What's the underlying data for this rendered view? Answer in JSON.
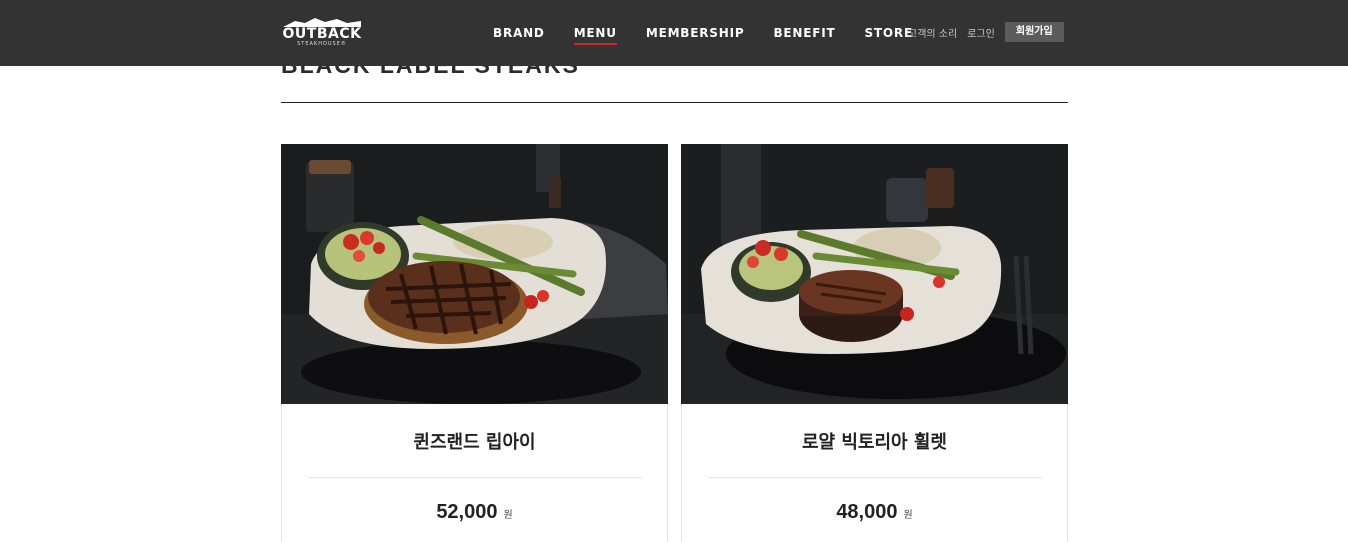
{
  "header": {
    "logo_text": "OUTBACK",
    "logo_subtext": "STEAKHOUSE®",
    "nav": [
      {
        "label": "BRAND",
        "active": false
      },
      {
        "label": "MENU",
        "active": true
      },
      {
        "label": "MEMBERSHIP",
        "active": false
      },
      {
        "label": "BENEFIT",
        "active": false
      },
      {
        "label": "STORE",
        "active": false
      }
    ],
    "util_links": [
      "고객의 소리",
      "로그인"
    ],
    "join_label": "회원가입",
    "accent_color": "#d2262f"
  },
  "section": {
    "title": "BLACK LABEL STEAKS"
  },
  "menu_items": [
    {
      "name": "퀸즈랜드 립아이",
      "price": "52,000",
      "unit": "원",
      "image_icon": "ribeye-steak-plate-image"
    },
    {
      "name": "로얄 빅토리아 휠렛",
      "price": "48,000",
      "unit": "원",
      "image_icon": "fillet-steak-plate-image"
    }
  ]
}
